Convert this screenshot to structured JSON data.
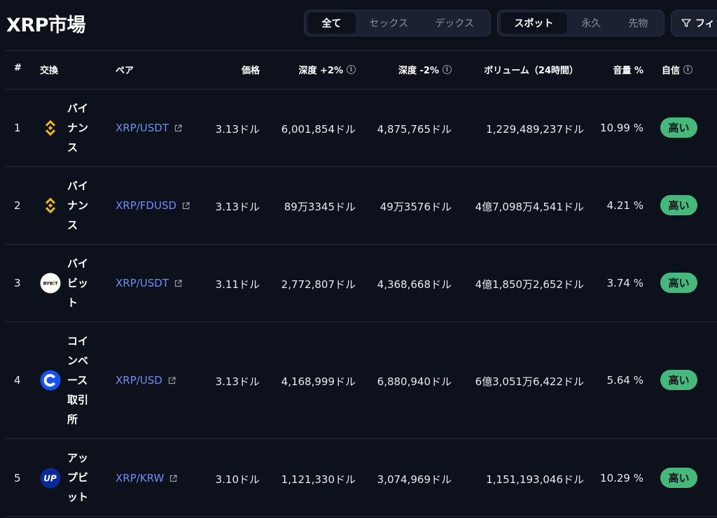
{
  "title": "XRP市場",
  "type_filter": {
    "options": [
      "全て",
      "セックス",
      "デックス"
    ],
    "active": 0
  },
  "market_filter": {
    "options": [
      "スポット",
      "永久",
      "先物"
    ],
    "active": 0
  },
  "filter_button": {
    "label": "フィ"
  },
  "columns": {
    "rank": "#",
    "exchange": "交換",
    "pair": "ペア",
    "price": "価格",
    "depth_plus": "深度 +2%",
    "depth_minus": "深度 -2%",
    "volume": "ボリューム（24時間）",
    "volume_pct": "音量 %",
    "confidence": "自信"
  },
  "rows": [
    {
      "rank": "1",
      "exchange": "バイナンス",
      "logo": "binance-logo",
      "pair": "XRP/USDT",
      "price": "3.13ドル",
      "depth_plus": "6,001,854ドル",
      "depth_minus": "4,875,765ドル",
      "volume": "1,229,489,237ドル",
      "volume_pct": "10.99 %",
      "confidence": "高い"
    },
    {
      "rank": "2",
      "exchange": "バイナンス",
      "logo": "binance-logo",
      "pair": "XRP/FDUSD",
      "price": "3.13ドル",
      "depth_plus": "89万3345ドル",
      "depth_minus": "49万3576ドル",
      "volume": "4億7,098万4,541ドル",
      "volume_pct": "4.21 %",
      "confidence": "高い"
    },
    {
      "rank": "3",
      "exchange": "バイビット",
      "logo": "bybit-logo",
      "pair": "XRP/USDT",
      "price": "3.11ドル",
      "depth_plus": "2,772,807ドル",
      "depth_minus": "4,368,668ドル",
      "volume": "4億1,850万2,652ドル",
      "volume_pct": "3.74 %",
      "confidence": "高い"
    },
    {
      "rank": "4",
      "exchange": "コインベース取引所",
      "logo": "coinbase-logo",
      "pair": "XRP/USD",
      "price": "3.13ドル",
      "depth_plus": "4,168,999ドル",
      "depth_minus": "6,880,940ドル",
      "volume": "6億3,051万6,422ドル",
      "volume_pct": "5.64 %",
      "confidence": "高い"
    },
    {
      "rank": "5",
      "exchange": "アップビット",
      "logo": "upbit-logo",
      "pair": "XRP/KRW",
      "price": "3.10ドル",
      "depth_plus": "1,121,330ドル",
      "depth_minus": "3,074,969ドル",
      "volume": "1,151,193,046ドル",
      "volume_pct": "10.29 %",
      "confidence": "高い"
    }
  ],
  "colors": {
    "background": "#0d111c",
    "link": "#6f8df5",
    "badge": "#45b97c",
    "binance": "#f0b90b",
    "coinbase": "#1652f0",
    "upbit": "#0a2a9a"
  }
}
